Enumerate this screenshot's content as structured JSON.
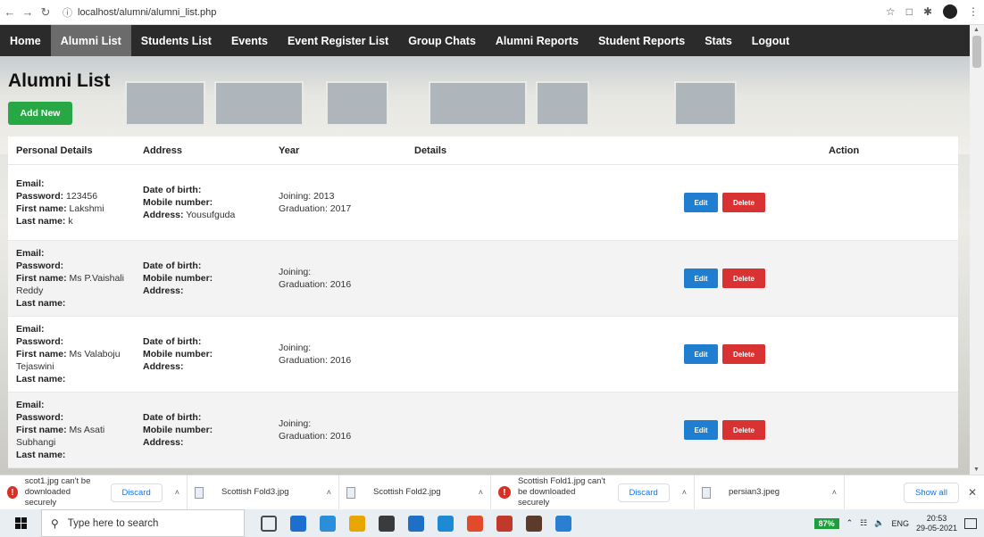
{
  "browser": {
    "url": "localhost/alumni/alumni_list.php"
  },
  "nav": {
    "items": [
      {
        "label": "Home",
        "active": false
      },
      {
        "label": "Alumni List",
        "active": true
      },
      {
        "label": "Students List",
        "active": false
      },
      {
        "label": "Events",
        "active": false
      },
      {
        "label": "Event Register List",
        "active": false
      },
      {
        "label": "Group Chats",
        "active": false
      },
      {
        "label": "Alumni Reports",
        "active": false
      },
      {
        "label": "Student Reports",
        "active": false
      },
      {
        "label": "Stats",
        "active": false
      },
      {
        "label": "Logout",
        "active": false
      }
    ]
  },
  "page": {
    "title": "Alumni List",
    "add_label": "Add New"
  },
  "table": {
    "headers": [
      "Personal Details",
      "Address",
      "Year",
      "Details",
      "",
      "Action"
    ],
    "labels": {
      "email": "Email:",
      "password": "Password:",
      "first_name": "First name:",
      "last_name": "Last name:",
      "dob": "Date of birth:",
      "mobile": "Mobile number:",
      "address": "Address:",
      "joining": "Joining:",
      "graduation": "Graduation:"
    },
    "edit_label": "Edit",
    "delete_label": "Delete",
    "rows": [
      {
        "email": "",
        "password": "123456",
        "first_name": "Lakshmi",
        "last_name": "k",
        "dob": "",
        "mobile": "",
        "address": "Yousufguda",
        "joining": "2013",
        "graduation": "2017"
      },
      {
        "email": "",
        "password": "",
        "first_name": "Ms P.Vaishali Reddy",
        "last_name": "",
        "dob": "",
        "mobile": "",
        "address": "",
        "joining": "",
        "graduation": "2016"
      },
      {
        "email": "",
        "password": "",
        "first_name": "Ms Valaboju Tejaswini",
        "last_name": "",
        "dob": "",
        "mobile": "",
        "address": "",
        "joining": "",
        "graduation": "2016"
      },
      {
        "email": "",
        "password": "",
        "first_name": "Ms Asati Subhangi",
        "last_name": "",
        "dob": "",
        "mobile": "",
        "address": "",
        "joining": "",
        "graduation": "2016"
      }
    ]
  },
  "downloads": {
    "items": [
      {
        "name": "scot1.jpg can't be downloaded securely",
        "warning": true,
        "discard": "Discard"
      },
      {
        "name": "Scottish Fold3.jpg",
        "warning": false
      },
      {
        "name": "Scottish Fold2.jpg",
        "warning": false
      },
      {
        "name": "Scottish Fold1.jpg can't be downloaded securely",
        "warning": true,
        "discard": "Discard"
      },
      {
        "name": "persian3.jpeg",
        "warning": false
      }
    ],
    "show_all": "Show all"
  },
  "taskbar": {
    "search_placeholder": "Type here to search",
    "battery": "87%",
    "lang": "ENG",
    "time": "20:53",
    "date": "29-05-2021",
    "app_colors": [
      "#4a4a4a",
      "#1c6fd1",
      "#2a8fd8",
      "#e8a600",
      "#3b3b3b",
      "#1f6fc4",
      "#1f8ad4",
      "#e24a2b",
      "#c1392b",
      "#5c3b2a",
      "#2a7fd0"
    ]
  }
}
